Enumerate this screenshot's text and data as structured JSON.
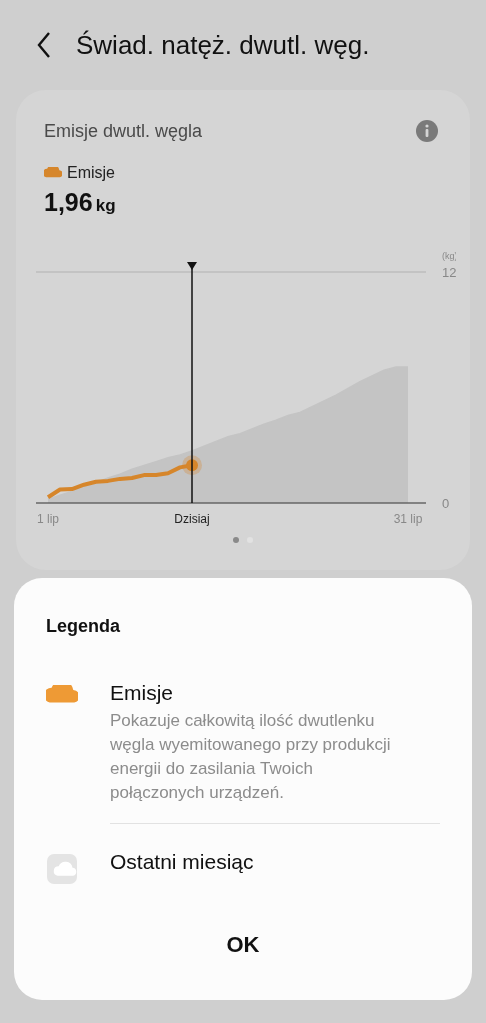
{
  "header": {
    "title": "Świad. natęż. dwutl. węg."
  },
  "card": {
    "title": "Emisje dwutl. węgla",
    "legend_label": "Emisje",
    "value": "1,96",
    "unit": "kg",
    "chart_data": {
      "type": "area",
      "xlim": [
        0,
        32.5
      ],
      "ylabel": "(kg)",
      "x": [
        1,
        2,
        3,
        4,
        5,
        6,
        7,
        8,
        9,
        10,
        11,
        12,
        13,
        14,
        15,
        16,
        17,
        18,
        19,
        20,
        21,
        22,
        23,
        24,
        25,
        26,
        27,
        28,
        29,
        30,
        31
      ],
      "ylim": [
        0,
        12
      ],
      "yticks": [
        0,
        12
      ],
      "xticks": [
        {
          "value": 1,
          "label": "1 lip"
        },
        {
          "value": 13,
          "label": "Dzisiaj"
        },
        {
          "value": 31,
          "label": "31 lip"
        }
      ],
      "series": [
        {
          "type": "area",
          "color": "#c4c4c4",
          "values": [
            0.2,
            0.4,
            0.6,
            0.85,
            1.05,
            1.3,
            1.5,
            1.75,
            1.95,
            2.15,
            2.35,
            2.5,
            2.7,
            2.95,
            3.2,
            3.45,
            3.6,
            3.85,
            4.1,
            4.3,
            4.55,
            4.7,
            5.0,
            5.3,
            5.6,
            5.95,
            6.3,
            6.6,
            6.9,
            7.07,
            7.07
          ]
        },
        {
          "type": "line",
          "color": "#d6862b",
          "values": [
            0.3,
            0.7,
            0.72,
            0.95,
            1.1,
            1.15,
            1.25,
            1.3,
            1.45,
            1.45,
            1.55,
            1.85,
            1.96,
            null,
            null,
            null,
            null,
            null,
            null,
            null,
            null,
            null,
            null,
            null,
            null,
            null,
            null,
            null,
            null,
            null,
            null
          ]
        }
      ]
    },
    "pages": [
      {
        "selected": true
      },
      {
        "selected": false
      }
    ]
  },
  "dialog": {
    "title": "Legenda",
    "items": [
      {
        "kind": "filled",
        "label": "Emisje",
        "description": "Pokazuje całkowitą ilość dwutlenku węgla wyemitowanego przy produkcji energii do zasilania Twoich połączonych urządzeń."
      },
      {
        "kind": "boxed",
        "label": "Ostatni miesiąc"
      }
    ],
    "button": "OK"
  }
}
